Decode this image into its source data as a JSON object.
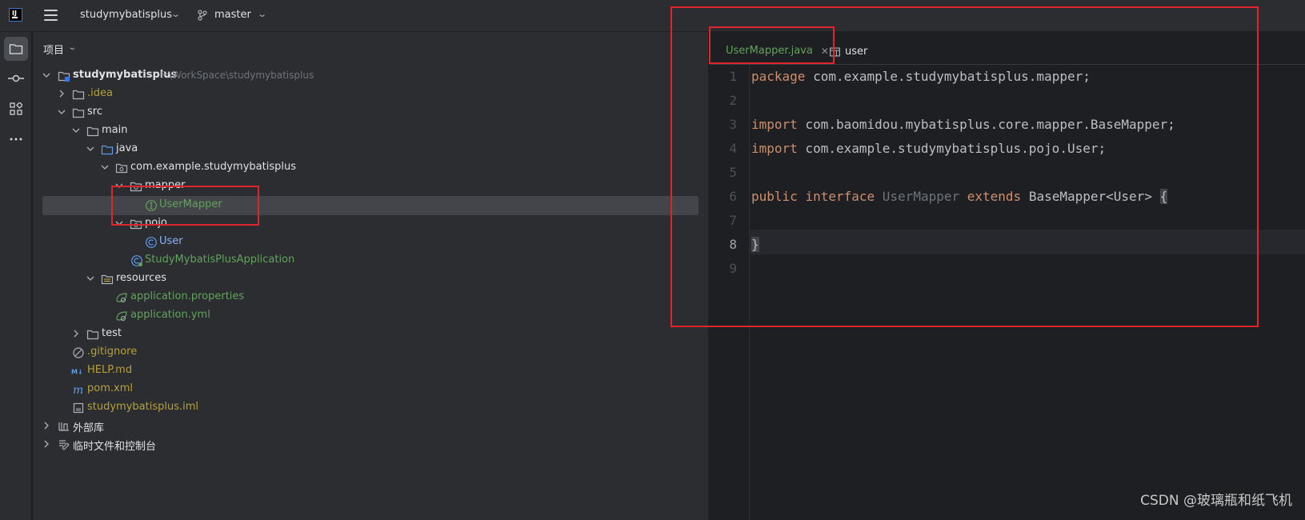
{
  "titlebar": {
    "project_name": "studymybatisplus",
    "branch": "master"
  },
  "project_panel": {
    "header": "项目",
    "tree": [
      {
        "label": "studymybatisplus",
        "path": "F:\\WorkSpace\\studymybatisplus",
        "icon": "module-icon"
      },
      {
        "label": ".idea",
        "icon": "folder-icon"
      },
      {
        "label": "src",
        "icon": "folder-icon"
      },
      {
        "label": "main",
        "icon": "folder-icon"
      },
      {
        "label": "java",
        "icon": "source-folder-icon"
      },
      {
        "label": "com.example.studymybatisplus",
        "icon": "package-icon"
      },
      {
        "label": "mapper",
        "icon": "package-icon"
      },
      {
        "label": "UserMapper",
        "icon": "interface-icon"
      },
      {
        "label": "pojo",
        "icon": "package-icon"
      },
      {
        "label": "User",
        "icon": "class-icon"
      },
      {
        "label": "StudyMybatisPlusApplication",
        "icon": "spring-boot-icon"
      },
      {
        "label": "resources",
        "icon": "resources-folder-icon"
      },
      {
        "label": "application.properties",
        "icon": "spring-config-icon"
      },
      {
        "label": "application.yml",
        "icon": "spring-config-icon"
      },
      {
        "label": "test",
        "icon": "folder-icon"
      },
      {
        "label": ".gitignore",
        "icon": "ignore-file-icon"
      },
      {
        "label": "HELP.md",
        "icon": "markdown-icon"
      },
      {
        "label": "pom.xml",
        "icon": "maven-icon"
      },
      {
        "label": "studymybatisplus.iml",
        "icon": "iml-file-icon"
      },
      {
        "label": "外部库",
        "icon": "library-icon"
      },
      {
        "label": "临时文件和控制台",
        "icon": "scratches-icon"
      }
    ]
  },
  "editor": {
    "tabs": [
      {
        "label": "UserMapper.java",
        "active": true
      },
      {
        "label": "user",
        "active": false
      }
    ],
    "line_numbers": [
      "1",
      "2",
      "3",
      "4",
      "5",
      "6",
      "7",
      "8",
      "9"
    ],
    "current_line": "8",
    "code": {
      "l1_kw": "package",
      "l1_rest": " com.example.studymybatisplus.mapper;",
      "l3_kw": "import",
      "l3_rest": " com.baomidou.mybatisplus.core.mapper.BaseMapper;",
      "l4_kw": "import",
      "l4_rest": " com.example.studymybatisplus.pojo.User;",
      "l6_kw1": "public",
      "l6_kw2": "interface",
      "l6_name": "UserMapper",
      "l6_kw3": "extends",
      "l6_rest": " BaseMapper<User> ",
      "l6_brace": "{",
      "l8_brace": "}"
    }
  },
  "watermark": "CSDN @玻璃瓶和纸飞机",
  "colors": {
    "accent": "#3574f0",
    "keyword": "#cf8e6d",
    "highlight_box": "#e0242c",
    "vcs_ignored_file": "#b5a13a",
    "vcs_new_file": "#62a35c"
  }
}
